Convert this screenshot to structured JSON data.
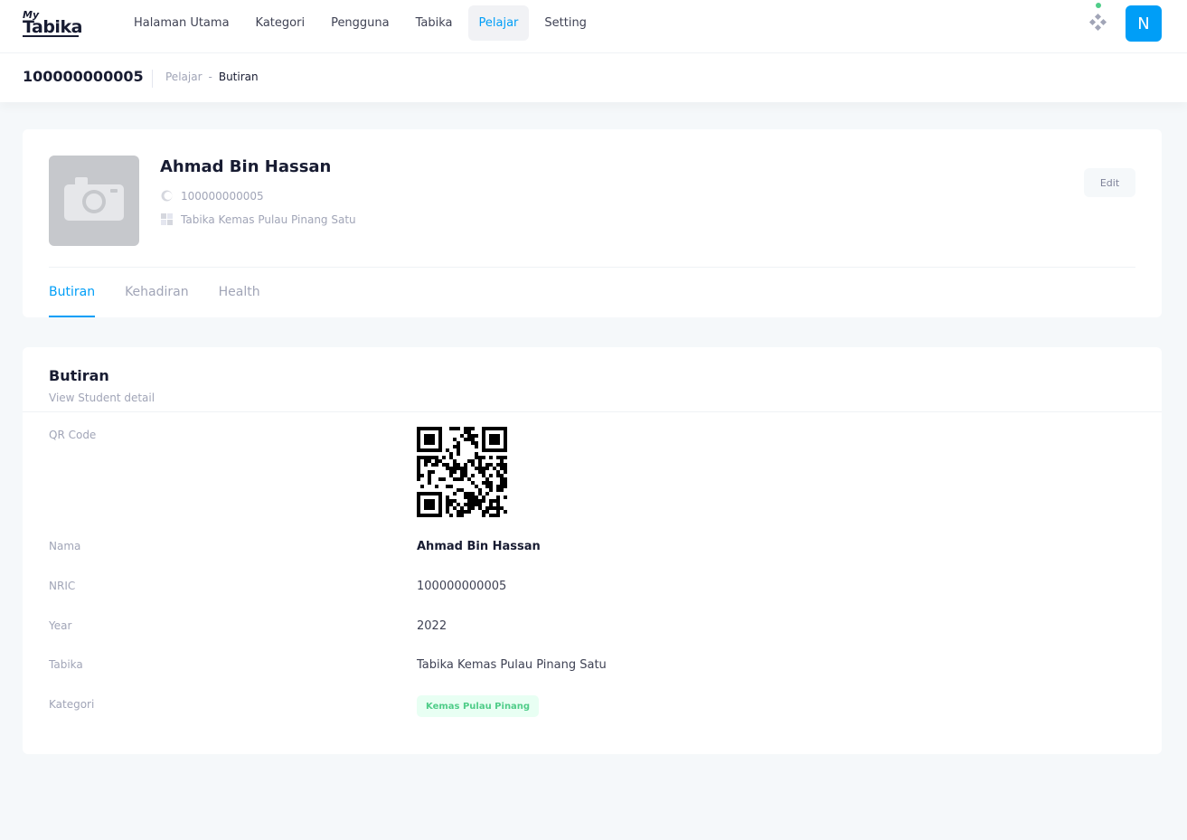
{
  "app": {
    "logo_my": "My",
    "logo_name": "Tabika"
  },
  "nav": {
    "items": [
      {
        "label": "Halaman Utama",
        "active": false
      },
      {
        "label": "Kategori",
        "active": false
      },
      {
        "label": "Pengguna",
        "active": false
      },
      {
        "label": "Tabika",
        "active": false
      },
      {
        "label": "Pelajar",
        "active": true
      },
      {
        "label": "Setting",
        "active": false
      }
    ]
  },
  "user": {
    "initial": "N"
  },
  "toolbar": {
    "title": "100000000005",
    "breadcrumb": [
      "Pelajar",
      "-",
      "Butiran"
    ]
  },
  "profile": {
    "name": "Ahmad Bin Hassan",
    "nric": "100000000005",
    "school": "Tabika Kemas Pulau Pinang Satu",
    "edit_label": "Edit",
    "photo_placeholder_icon": "camera-icon"
  },
  "tabs": [
    {
      "label": "Butiran",
      "active": true
    },
    {
      "label": "Kehadiran",
      "active": false
    },
    {
      "label": "Health",
      "active": false
    }
  ],
  "details": {
    "title": "Butiran",
    "subtitle": "View Student detail",
    "fields": {
      "qr_label": "QR Code",
      "name_label": "Nama",
      "name_value": "Ahmad Bin Hassan",
      "nric_label": "NRIC",
      "nric_value": "100000000005",
      "year_label": "Year",
      "year_value": "2022",
      "school_label": "Tabika",
      "school_value": "Tabika Kemas Pulau Pinang Satu",
      "category_label": "Kategori",
      "category_value": "Kemas Pulau Pinang"
    }
  },
  "colors": {
    "primary": "#009ef7",
    "success": "#50cd89",
    "success_light": "#e8fff3",
    "muted": "#a1a5b7",
    "dark": "#181c32"
  }
}
